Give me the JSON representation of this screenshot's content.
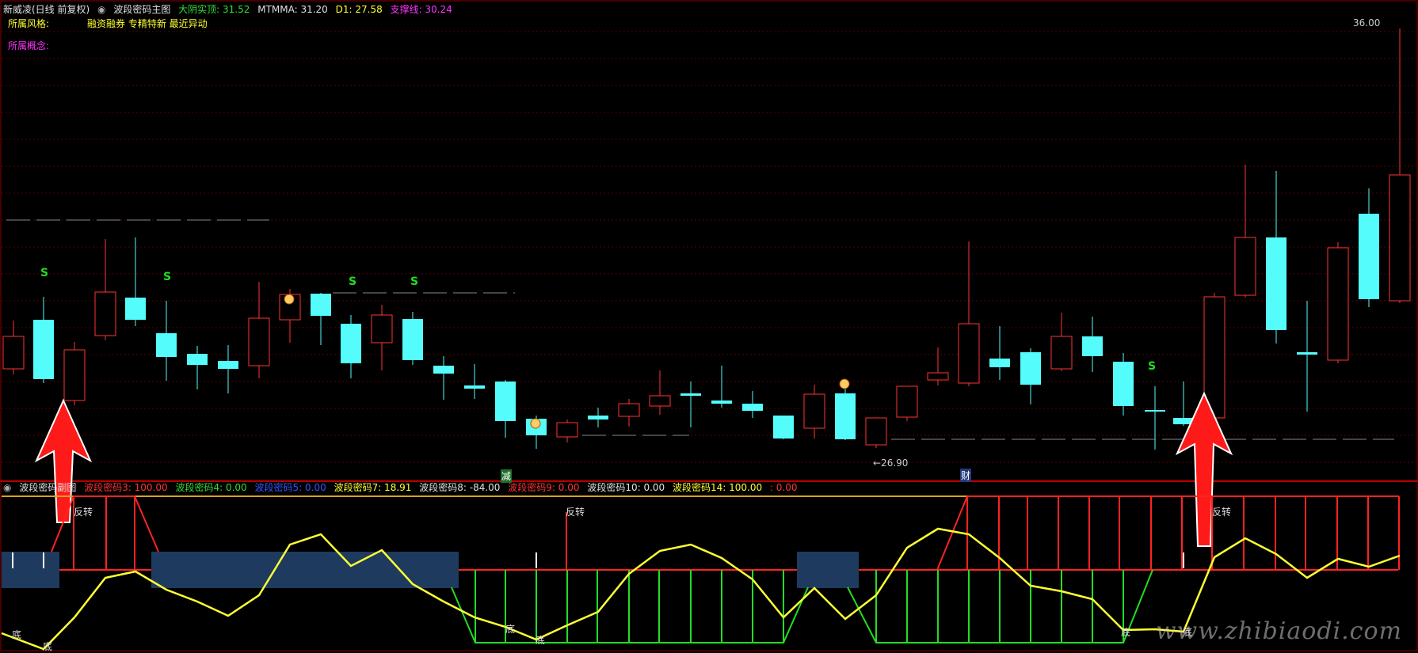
{
  "header": {
    "stock": "新威凌(日线 前复权)",
    "indicator_name": "波段密码主图",
    "da_yin_shi_ding": "大阴实顶: 31.52",
    "mtmma": "MTMMA: 31.20",
    "d1": "D1: 27.58",
    "zhi_cheng_xian": "支撑线: 30.24",
    "style_label": "所属风格:",
    "style_value": "融资融券 专精特新 最近异动",
    "concept_label": "所属概念:"
  },
  "price_labels": {
    "high": "36.00",
    "low": "←26.90"
  },
  "markers": {
    "s": "S",
    "jian": "减",
    "cai": "财"
  },
  "lower_header": {
    "name": "波段密码副图",
    "c3": "波段密码3: 100.00",
    "c4": "波段密码4: 0.00",
    "c5": "波段密码5: 0.00",
    "c7": "波段密码7: 18.91",
    "c8": "波段密码8: -84.00",
    "c9": "波段密码9: 0.00",
    "c10": "波段密码10: 0.00",
    "c14": "波段密码14: 100.00",
    "c_last": ": 0.00"
  },
  "lower_labels": {
    "fanzhuan": "反转",
    "di": "底"
  },
  "watermark": "www.zhibiaodi.com",
  "colors": {
    "up": "#ff3333",
    "down": "#54fcfc",
    "yellow_line": "#ffff33",
    "green": "#22dd22",
    "navy": "#1e3a5f",
    "grid": "#8b0000"
  }
}
